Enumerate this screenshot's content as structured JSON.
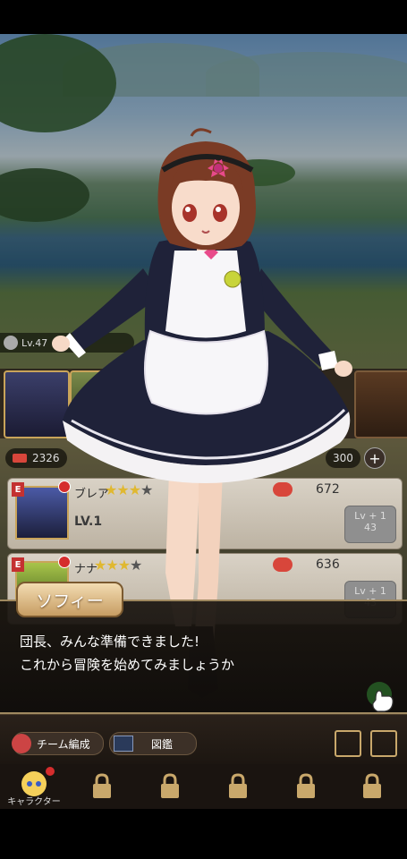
{
  "hud": {
    "level_text": "Lv.47",
    "power_total": "2326",
    "gems": "300",
    "plus": "+"
  },
  "characters": [
    {
      "rank": "E",
      "name": "ブレア",
      "stars": 3,
      "max_stars": 4,
      "level": "LV.1",
      "power": "672",
      "levelup": "Lv + 1",
      "cost": "43"
    },
    {
      "rank": "E",
      "name": "ナナ",
      "stars": 3,
      "max_stars": 4,
      "level": "",
      "power": "636",
      "levelup": "Lv + 1",
      "cost": "43"
    }
  ],
  "dialog": {
    "speaker": "ソフィー",
    "line1": "団長、みんな準備できました!",
    "line2": "これから冒険を始めてみましょうか"
  },
  "bottom": {
    "team_button": "チーム編成",
    "book_button": "図鑑"
  },
  "tabs": [
    {
      "label": "キャラクター",
      "locked": false
    },
    {
      "label": "",
      "locked": true
    },
    {
      "label": "",
      "locked": true
    },
    {
      "label": "",
      "locked": true
    },
    {
      "label": "",
      "locked": true
    },
    {
      "label": "",
      "locked": true
    }
  ],
  "colors": {
    "accent_gold": "#c9a45a",
    "power_red": "#d8463b",
    "star": "#e0b830",
    "dialog_bg": "#1a140f"
  }
}
